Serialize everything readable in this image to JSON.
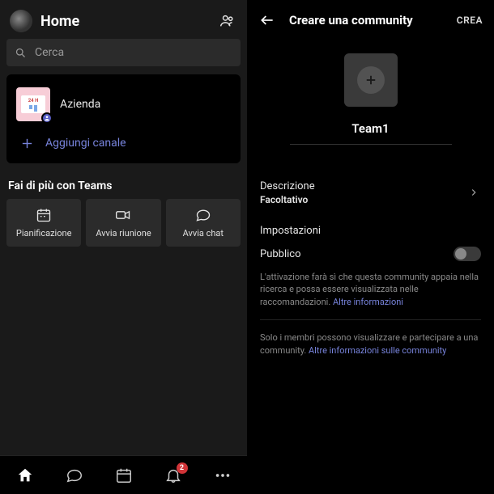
{
  "left": {
    "title": "Home",
    "search_placeholder": "Cerca",
    "channel": {
      "name": "Azienda",
      "thumb_text": "24 H"
    },
    "add_channel": "Aggiungi canale",
    "more_title": "Fai di più con Teams",
    "actions": {
      "schedule": "Pianificazione",
      "meeting": "Avvia riunione",
      "chat": "Avvia chat"
    },
    "nav_badge": "2"
  },
  "right": {
    "title": "Creare una community",
    "create": "CREA",
    "team_name": "Team1",
    "description": "Descrizione",
    "optional": "Facoltativo",
    "settings": "Impostazioni",
    "public": "Pubblico",
    "hint_prefix": "L'attivazione farà sì che questa community appaia nella ricerca e possa essere visualizzata nelle raccomandazioni. ",
    "hint_link": "Altre informazioni",
    "info_prefix": "Solo i membri possono visualizzare e partecipare a una community. ",
    "info_link": "Altre informazioni sulle community"
  }
}
